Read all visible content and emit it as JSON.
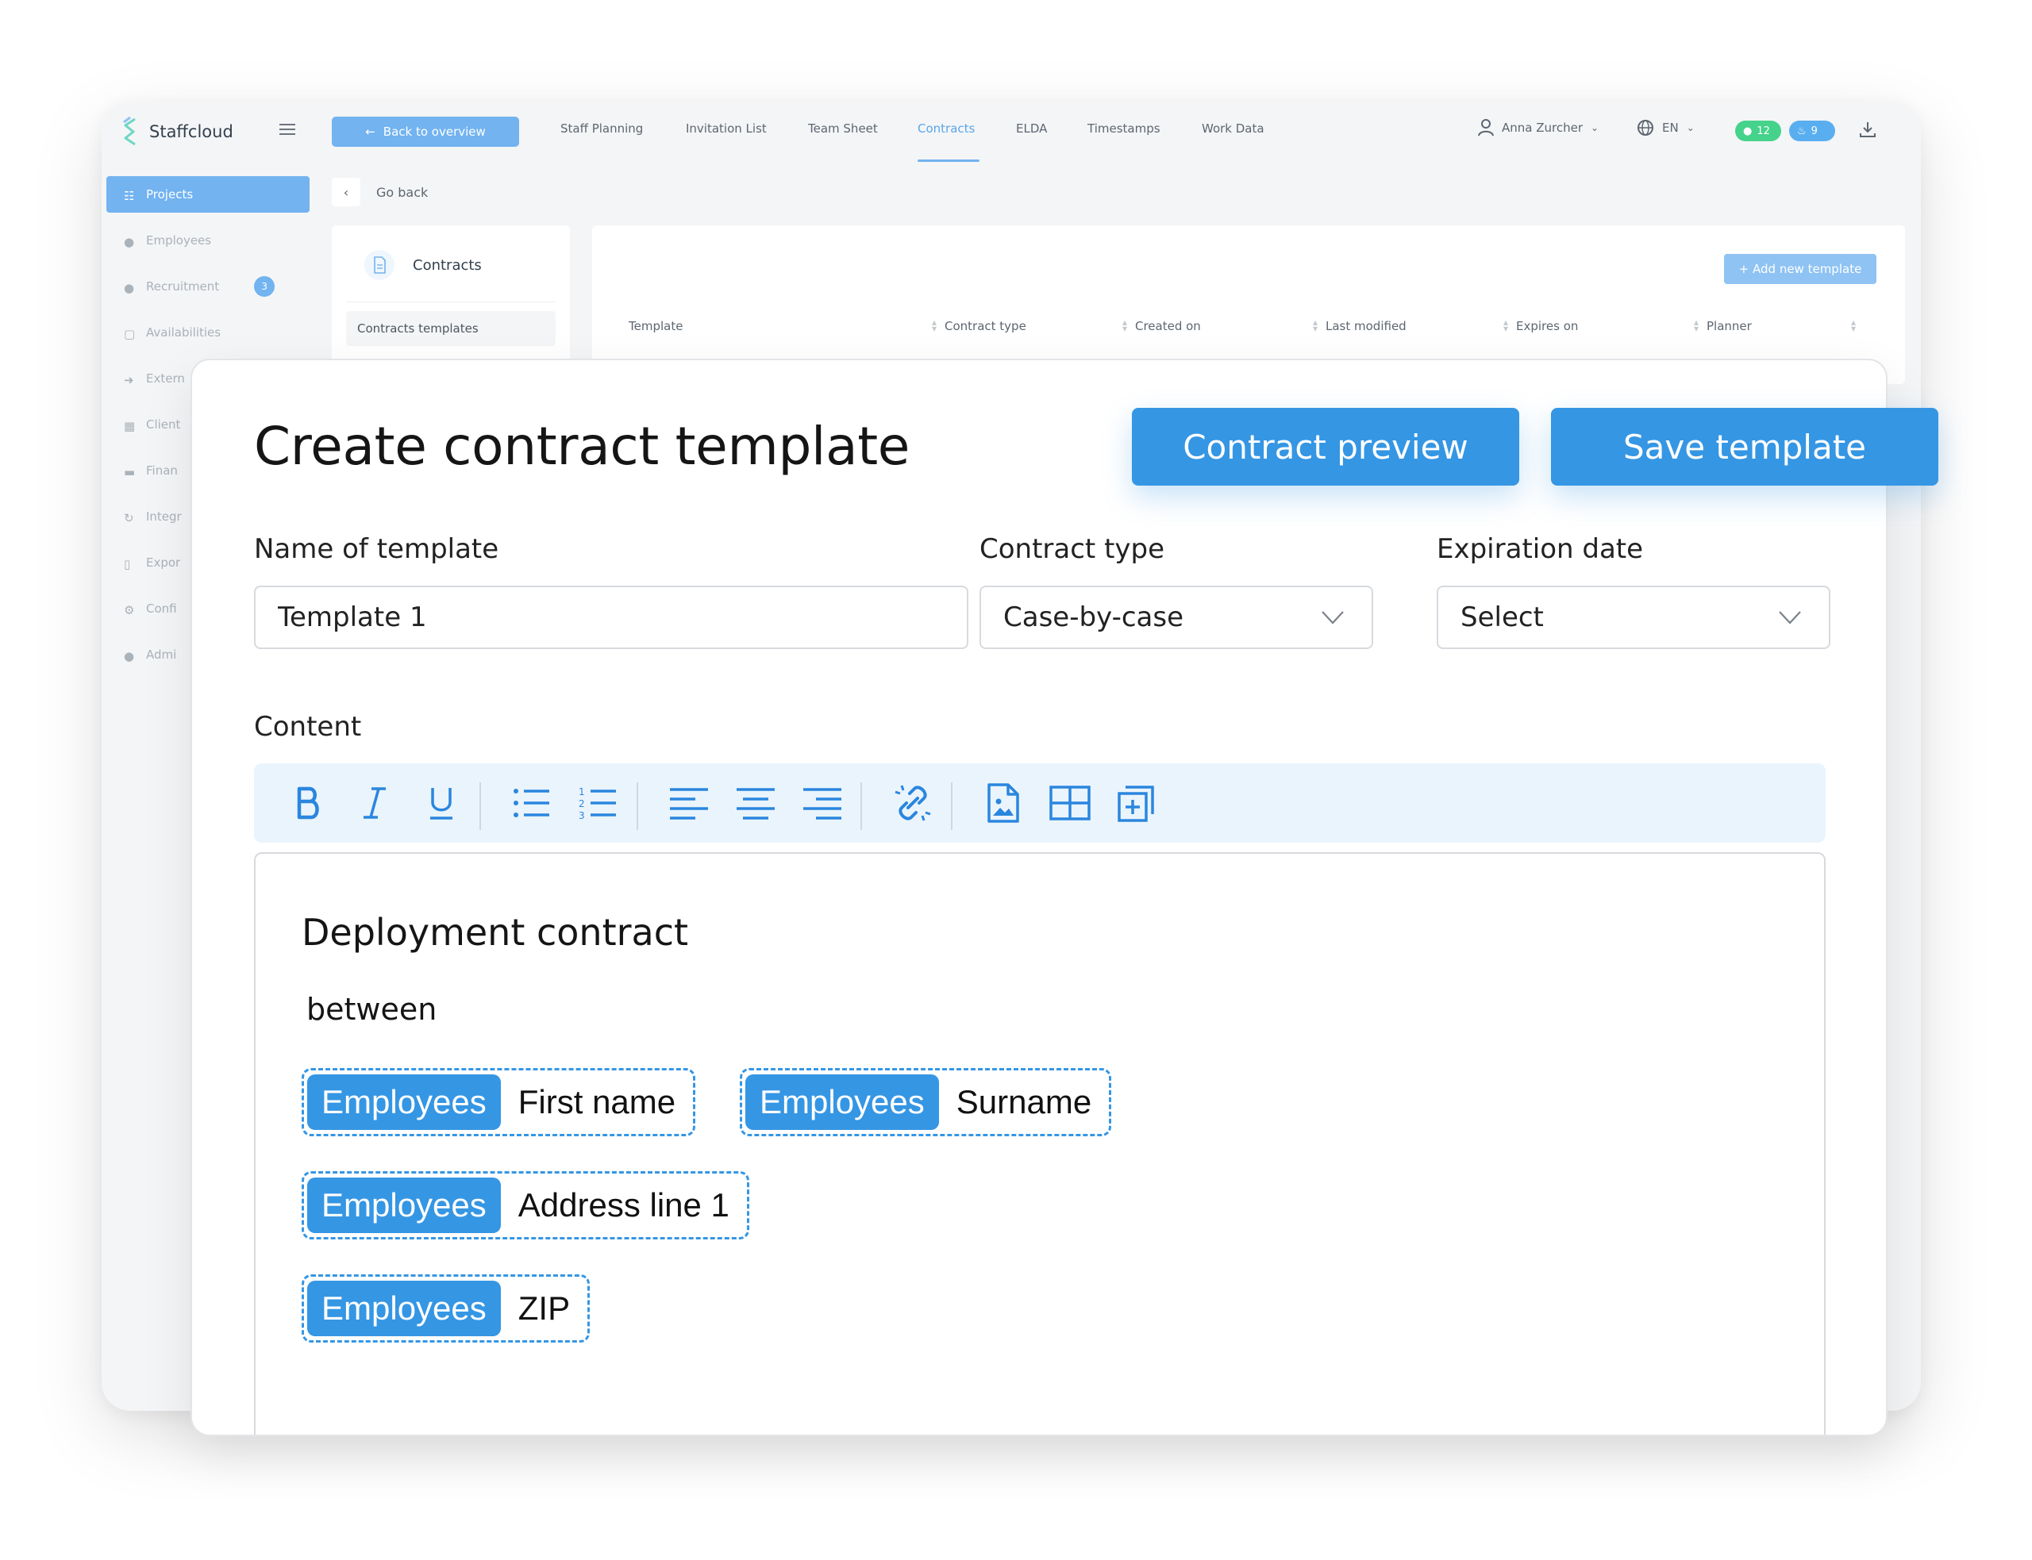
{
  "app": {
    "brand": "Staffcloud",
    "back_button": "Back to overview",
    "nav": [
      "Staff Planning",
      "Invitation List",
      "Team Sheet",
      "Contracts",
      "ELDA",
      "Timestamps",
      "Work Data"
    ],
    "active_nav": "Contracts",
    "user_name": "Anna Zurcher",
    "language": "EN",
    "messages_count": "12",
    "notifications_count": "9",
    "sidebar": [
      {
        "label": "Projects",
        "icon": "sitemap-icon",
        "active": true
      },
      {
        "label": "Employees",
        "icon": "users-icon"
      },
      {
        "label": "Recruitment",
        "icon": "user-plus-icon",
        "badge": "3"
      },
      {
        "label": "Availabilities",
        "icon": "calendar-icon"
      },
      {
        "label": "Extern",
        "icon": "sign-in-icon"
      },
      {
        "label": "Client",
        "icon": "building-icon"
      },
      {
        "label": "Finan",
        "icon": "money-icon"
      },
      {
        "label": "Integr",
        "icon": "sync-icon"
      },
      {
        "label": "Expor",
        "icon": "file-icon"
      },
      {
        "label": "Confi",
        "icon": "gear-icon"
      },
      {
        "label": "Admi",
        "icon": "admin-icon"
      }
    ],
    "go_back": "Go back",
    "contracts_panel": {
      "title": "Contracts",
      "subitem": "Contracts templates"
    },
    "table": {
      "add_button": "+ Add new template",
      "columns": [
        "Template",
        "Contract type",
        "Created on",
        "Last modified",
        "Expires on",
        "Planner"
      ]
    },
    "colors": {
      "primary": "#3596e4",
      "accent_light": "#72b3f0",
      "green": "#45d28b"
    }
  },
  "modal": {
    "title": "Create contract template",
    "preview_button": "Contract preview",
    "save_button": "Save template",
    "name_label": "Name of template",
    "name_value": "Template 1",
    "type_label": "Contract type",
    "type_value": "Case-by-case",
    "expiration_label": "Expiration date",
    "expiration_value": "Select",
    "content_label": "Content",
    "toolbar_icons": [
      "bold-icon",
      "italic-icon",
      "underline-icon",
      "bullet-list-icon",
      "numbered-list-icon",
      "align-left-icon",
      "align-center-icon",
      "align-right-icon",
      "link-icon",
      "image-file-icon",
      "table-icon",
      "add-block-icon"
    ],
    "document": {
      "title": "Deployment contract",
      "between": "between",
      "placeholders": [
        {
          "tag": "Employees",
          "field": "First name"
        },
        {
          "tag": "Employees",
          "field": "Surname"
        },
        {
          "tag": "Employees",
          "field": "Address line 1"
        },
        {
          "tag": "Employees",
          "field": "ZIP"
        }
      ]
    }
  }
}
